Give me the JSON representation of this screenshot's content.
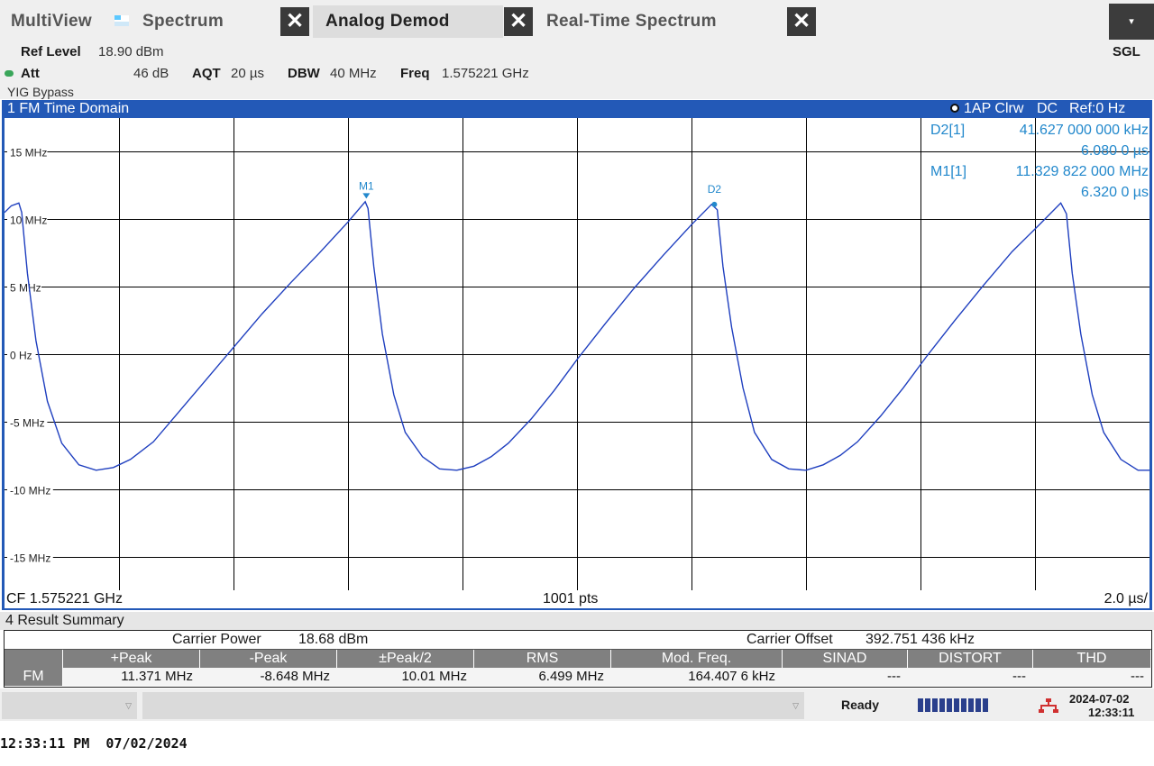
{
  "tabs": {
    "multiview": "MultiView",
    "spectrum": "Spectrum",
    "analog_demod": "Analog Demod",
    "realtime": "Real-Time Spectrum",
    "close_glyph": "✕"
  },
  "sgl_label": "SGL",
  "info": {
    "ref_level_label": "Ref Level",
    "ref_level_value": "18.90 dBm",
    "att_label": "Att",
    "att_value": "46 dB",
    "aqt_label": "AQT",
    "aqt_value": "20 µs",
    "dbw_label": "DBW",
    "dbw_value": "40 MHz",
    "freq_label": "Freq",
    "freq_value": "1.575221 GHz",
    "yig": "YIG Bypass"
  },
  "diagram": {
    "title": "1 FM Time Domain",
    "trace_info": "1AP Clrw",
    "coupling": "DC",
    "ref": "Ref:0 Hz",
    "footer_left": "CF 1.575221 GHz",
    "footer_center": "1001 pts",
    "footer_right": "2.0 µs/"
  },
  "markers": {
    "d2_label": "D2[1]",
    "d2_value": "41.627 000 000 kHz",
    "d2_time": "6.080 0 µs",
    "m1_label": "M1[1]",
    "m1_value": "11.329 822 000 MHz",
    "m1_time": "6.320 0 µs"
  },
  "chart_data": {
    "type": "line",
    "title": "1 FM Time Domain",
    "xlabel": "",
    "ylabel": "",
    "x_unit": "µs",
    "xlim": [
      0,
      20
    ],
    "ylim": [
      -17.5,
      17.5
    ],
    "y_unit": "MHz",
    "yticks": [
      15,
      10,
      5,
      0,
      -5,
      -10,
      -15
    ],
    "ytick_labels": [
      "15 MHz",
      "10 MHz",
      "5 MHz",
      "0 Hz",
      "-5 MHz",
      "-10 MHz",
      "-15 MHz"
    ],
    "grid": true,
    "series": [
      {
        "color": "#1f3fbf",
        "x": [
          0.0,
          0.12,
          0.25,
          0.3,
          0.4,
          0.55,
          0.75,
          1.0,
          1.3,
          1.6,
          1.9,
          2.2,
          2.6,
          3.0,
          3.5,
          4.0,
          4.5,
          5.0,
          5.5,
          6.0,
          6.3,
          6.35,
          6.45,
          6.6,
          6.8,
          7.0,
          7.3,
          7.6,
          7.9,
          8.2,
          8.5,
          8.8,
          9.2,
          9.6,
          10.0,
          10.5,
          11.0,
          11.5,
          12.0,
          12.35,
          12.45,
          12.55,
          12.7,
          12.9,
          13.1,
          13.4,
          13.7,
          14.0,
          14.3,
          14.6,
          14.9,
          15.3,
          15.7,
          16.1,
          16.6,
          17.1,
          17.6,
          18.1,
          18.45,
          18.55,
          18.65,
          18.8,
          19.0,
          19.2,
          19.5,
          19.8,
          20.0
        ],
        "y": [
          10.5,
          11.0,
          11.2,
          10.5,
          6.0,
          1.0,
          -3.5,
          -6.6,
          -8.2,
          -8.6,
          -8.4,
          -7.8,
          -6.5,
          -4.5,
          -2.0,
          0.5,
          3.0,
          5.3,
          7.5,
          9.8,
          11.3,
          10.8,
          6.5,
          1.5,
          -3.0,
          -5.8,
          -7.6,
          -8.5,
          -8.6,
          -8.3,
          -7.6,
          -6.6,
          -4.8,
          -2.7,
          -0.4,
          2.3,
          4.9,
          7.3,
          9.6,
          11.1,
          10.7,
          6.5,
          2.0,
          -2.5,
          -5.8,
          -7.8,
          -8.5,
          -8.6,
          -8.2,
          -7.5,
          -6.5,
          -4.6,
          -2.5,
          -0.2,
          2.5,
          5.1,
          7.6,
          9.7,
          11.2,
          10.4,
          6.0,
          1.5,
          -3.0,
          -5.8,
          -7.8,
          -8.6,
          -8.6
        ]
      }
    ],
    "markers": [
      {
        "label": "M1",
        "x": 6.32,
        "y": 11.33
      },
      {
        "label": "D2",
        "x": 12.4,
        "y": 11.1
      }
    ]
  },
  "result_summary": {
    "title": "4 Result Summary",
    "carrier_power_label": "Carrier Power",
    "carrier_power_value": "18.68 dBm",
    "carrier_offset_label": "Carrier Offset",
    "carrier_offset_value": "392.751 436 kHz",
    "headers": [
      "+Peak",
      "-Peak",
      "±Peak/2",
      "RMS",
      "Mod. Freq.",
      "SINAD",
      "DISTORT",
      "THD"
    ],
    "row_label": "FM",
    "values": [
      "11.371 MHz",
      "-8.648 MHz",
      "10.01 MHz",
      "6.499 MHz",
      "164.407 6 kHz",
      "---",
      "---",
      "---"
    ]
  },
  "status": {
    "state": "Ready",
    "date": "2024-07-02",
    "time": "12:33:11",
    "combo_arrow": "▽"
  },
  "os_timestamp": "12:33:11 PM  07/02/2024",
  "colors": {
    "diagram_frame": "#2359b7",
    "trace": "#1f3fbf",
    "marker_text": "#2288cc",
    "grid": "#000000"
  }
}
